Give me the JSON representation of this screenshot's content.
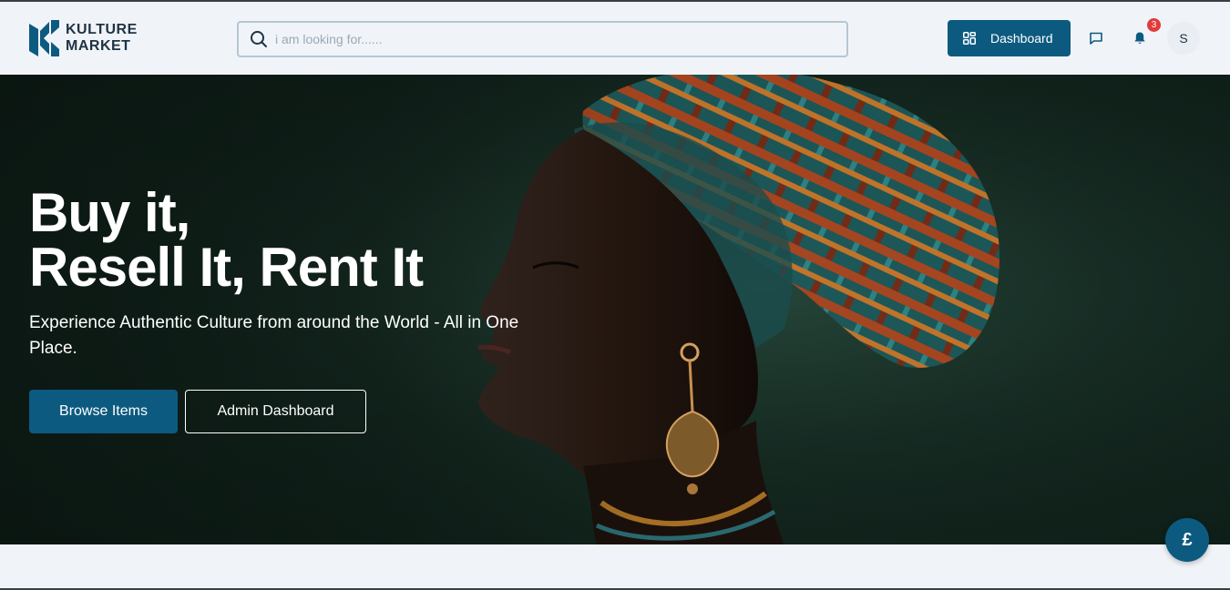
{
  "brand": {
    "line1": "KULTURE",
    "line2": "MARKET",
    "color": "#0d5a80"
  },
  "search": {
    "placeholder": "i am looking for......",
    "icon": "search-icon"
  },
  "header": {
    "dashboard_label": "Dashboard",
    "dashboard_icon": "grid-icon",
    "message_icon": "chat-icon",
    "notification_icon": "bell-icon",
    "notification_count": "3",
    "avatar_initial": "S"
  },
  "hero": {
    "title_line1": "Buy it,",
    "title_line2": "Resell It, Rent It",
    "subtitle": "Experience Authentic Culture from around the World - All in One Place.",
    "primary_button": "Browse Items",
    "secondary_button": "Admin Dashboard"
  },
  "fab": {
    "symbol": "£"
  },
  "colors": {
    "accent": "#0d5a80",
    "badge": "#e23b3b",
    "page_bg": "#f0f4f8"
  }
}
